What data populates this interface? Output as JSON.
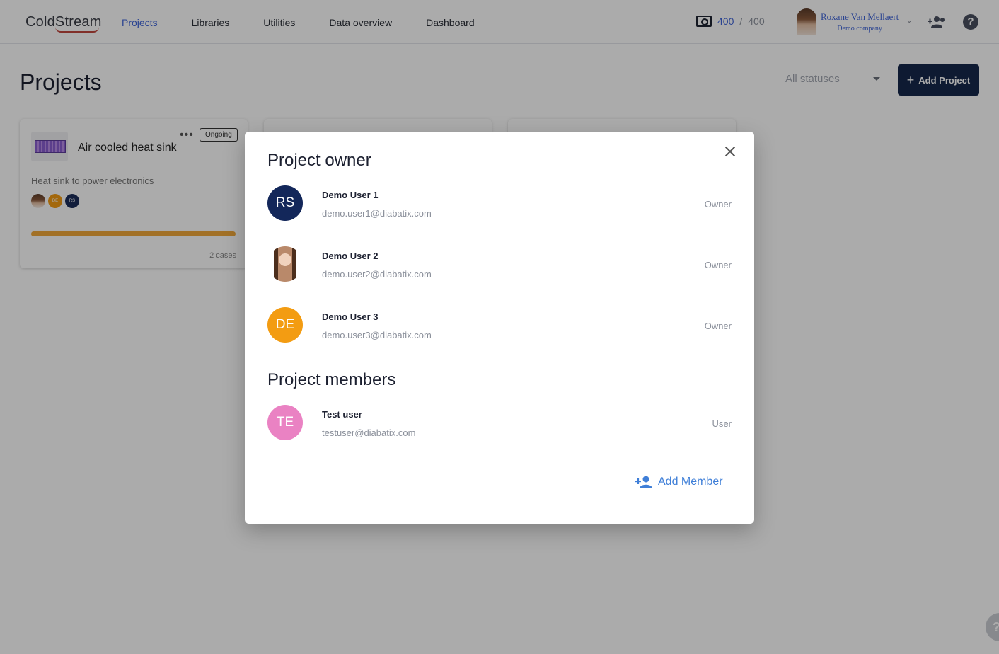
{
  "app": {
    "logo": "ColdStream",
    "nav": [
      "Projects",
      "Libraries",
      "Utilities",
      "Data overview",
      "Dashboard"
    ],
    "credits": {
      "used": "400",
      "total": "400"
    },
    "user": {
      "name": "Roxane Van Mellaert",
      "company": "Demo company"
    }
  },
  "page": {
    "title": "Projects",
    "status_filter": "All statuses",
    "add_project_label": "Add Project"
  },
  "cards": [
    {
      "title": "Air cooled heat sink",
      "badge": "Ongoing",
      "description": "Heat sink to power electronics",
      "avatars": [
        "DE",
        "RS"
      ],
      "progress": 1.0,
      "cases": "2 cases"
    }
  ],
  "modal": {
    "owner_title": "Project owner",
    "owners": [
      {
        "initials": "RS",
        "name": "Demo User 1",
        "email": "demo.user1@diabatix.com",
        "role": "Owner",
        "color": "#13275a"
      },
      {
        "initials": "",
        "name": "Demo User 2",
        "email": "demo.user2@diabatix.com",
        "role": "Owner",
        "color": "#ffffff"
      },
      {
        "initials": "DE",
        "name": "Demo User 3",
        "email": "demo.user3@diabatix.com",
        "role": "Owner",
        "color": "#f39c12"
      }
    ],
    "members_title": "Project members",
    "members": [
      {
        "initials": "TE",
        "name": "Test user",
        "email": "testuser@diabatix.com",
        "role": "User",
        "color": "#ea82c3"
      }
    ],
    "add_member_label": "Add Member"
  },
  "colors": {
    "accent": "#3f64d8",
    "primary_button": "#15284b",
    "progress": "#f2a93b",
    "link": "#3f7fd8"
  }
}
